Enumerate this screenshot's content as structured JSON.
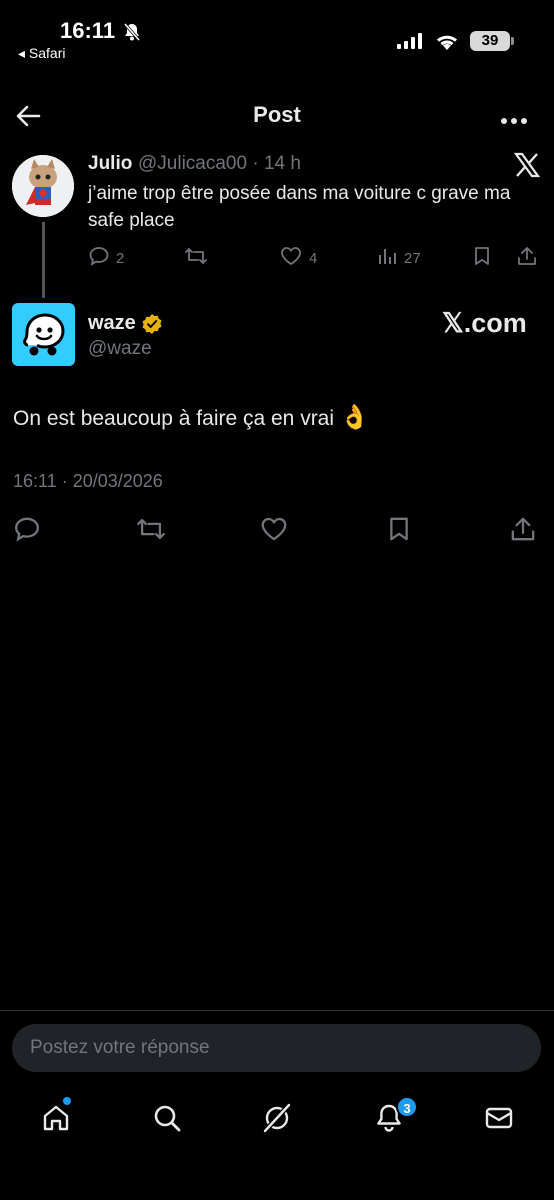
{
  "status_bar": {
    "time": "16:11",
    "back_app": "◂ Safari",
    "battery": "39"
  },
  "header": {
    "title": "Post"
  },
  "quoted_post": {
    "name": "Julio",
    "handle_meta": "@Julicaca00 · 14 h",
    "text": "j’aime trop être posée dans ma voiture c grave ma safe place",
    "replies": "2",
    "likes": "4",
    "views": "27"
  },
  "main_post": {
    "name": "waze",
    "handle": "@waze",
    "source": "𝕏.com",
    "text": "On est beaucoup à faire ça en vrai",
    "emoji": "👌",
    "timestamp": "16:11 · 20/03/2026"
  },
  "reply": {
    "placeholder": "Postez votre réponse"
  },
  "tab_bar": {
    "notifications_badge": "3"
  },
  "colors": {
    "background": "#000000",
    "text": "#e7e9ea",
    "muted": "#71767b",
    "accent": "#1d9bf0",
    "waze_brand": "#33ccff"
  },
  "icons": [
    "bell-slash-icon",
    "signal-icon",
    "wifi-icon",
    "battery-icon",
    "back-arrow-icon",
    "more-icon",
    "x-logo-icon",
    "reply-icon",
    "repost-icon",
    "like-icon",
    "views-icon",
    "bookmark-icon",
    "share-icon",
    "verified-badge-icon",
    "home-icon",
    "search-icon",
    "grok-icon",
    "notifications-icon",
    "messages-icon"
  ]
}
